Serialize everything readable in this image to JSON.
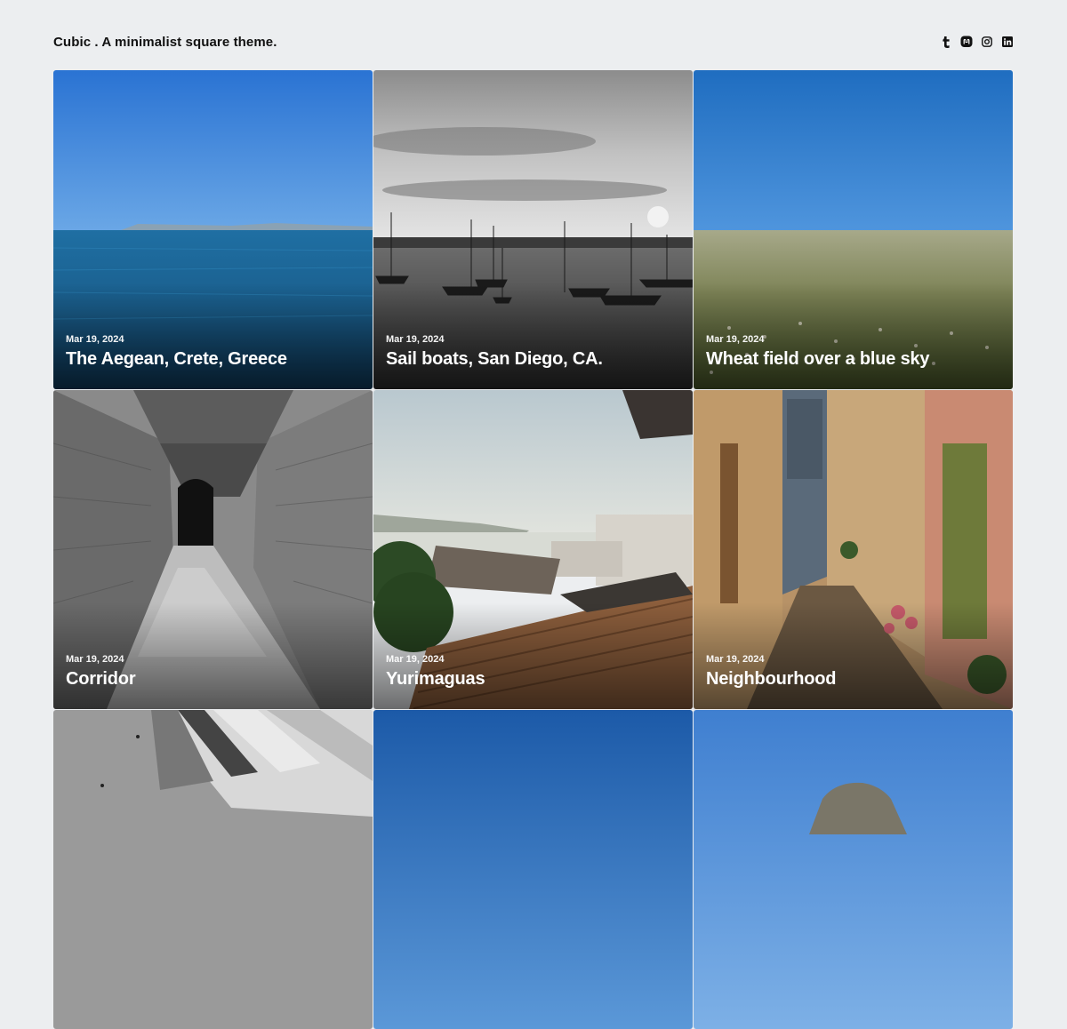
{
  "site": {
    "title": "Cubic . A minimalist square theme."
  },
  "social": [
    {
      "name": "tumblr",
      "icon": "tumblr-icon"
    },
    {
      "name": "mastodon",
      "icon": "mastodon-icon"
    },
    {
      "name": "instagram",
      "icon": "instagram-icon"
    },
    {
      "name": "linkedin",
      "icon": "linkedin-icon"
    }
  ],
  "posts": [
    {
      "date": "Mar 19, 2024",
      "title": "The Aegean, Crete, Greece"
    },
    {
      "date": "Mar 19, 2024",
      "title": "Sail boats, San Diego, CA."
    },
    {
      "date": "Mar 19, 2024",
      "title": "Wheat field over a blue sky"
    },
    {
      "date": "Mar 19, 2024",
      "title": "Corridor"
    },
    {
      "date": "Mar 19, 2024",
      "title": "Yurimaguas"
    },
    {
      "date": "Mar 19, 2024",
      "title": "Neighbourhood"
    }
  ],
  "colors": {
    "background": "#eceef0",
    "text": "#111111",
    "overlay_text": "#ffffff"
  }
}
